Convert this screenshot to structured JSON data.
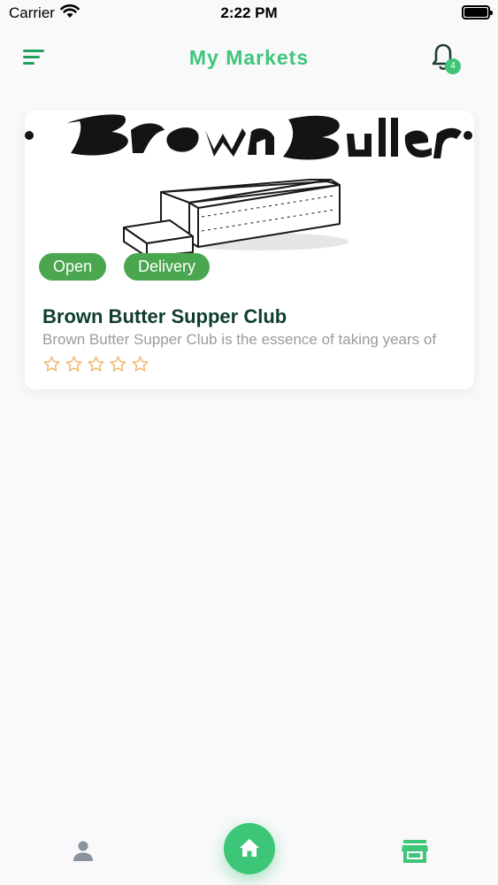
{
  "status_bar": {
    "carrier": "Carrier",
    "time": "2:22 PM"
  },
  "header": {
    "title": "My Markets",
    "menu_icon": "menu-icon",
    "notification_icon": "bell-icon",
    "notification_count": "4"
  },
  "market": {
    "name": "Brown Butter Supper Club",
    "description": "Brown Butter Supper Club is the essence of taking years of",
    "tags": [
      "Open",
      "Delivery"
    ],
    "rating": 0,
    "max_rating": 5
  },
  "bottom_nav": {
    "items": [
      "person-icon",
      "home-icon",
      "store-icon"
    ],
    "active": "home"
  },
  "colors": {
    "accent": "#3ec678",
    "chip": "#4aa64f",
    "title_text": "#0f3d2e",
    "star": "#f0b464"
  }
}
